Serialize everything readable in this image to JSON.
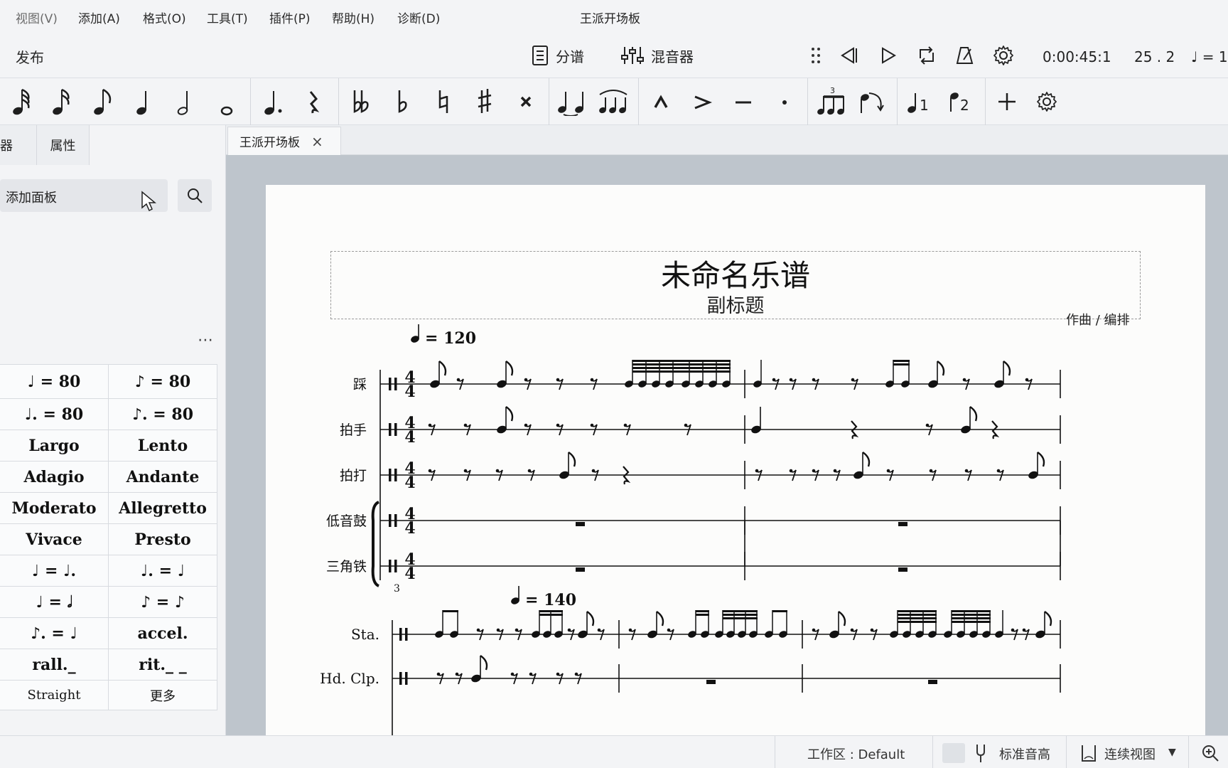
{
  "menu": {
    "items": [
      "视图(V)",
      "添加(A)",
      "格式(O)",
      "工具(T)",
      "插件(P)",
      "帮助(H)",
      "诊断(D)"
    ],
    "window_title": "王派开场板"
  },
  "toolbar": {
    "publish": "发布",
    "parts_label": "分谱",
    "mixer_label": "混音器",
    "time": "0:00:45:1",
    "position": "25 . 2",
    "tempo_readout": "= 1"
  },
  "note_input": {
    "durations": [
      "64th-note-icon",
      "32nd-note-icon",
      "eighth-note-icon",
      "quarter-note-icon",
      "half-note-icon",
      "whole-note-icon"
    ],
    "accidentals": [
      "double-flat-icon",
      "flat-icon",
      "natural-icon",
      "sharp-icon",
      "double-sharp-icon"
    ],
    "articulations": [
      "marcato-icon",
      "accent-icon",
      "tenuto-icon",
      "staccato-icon"
    ],
    "voice1": "1",
    "voice2": "2"
  },
  "left_panel": {
    "tab_instruments": "乐器",
    "tab_properties": "属性",
    "add_palette": "添加面板",
    "more": "⋯",
    "tempo_cells": [
      "♩ = 80",
      "♪ = 80",
      "♩. = 80",
      "♪. = 80",
      "Largo",
      "Lento",
      "Adagio",
      "Andante",
      "Moderato",
      "Allegretto",
      "Vivace",
      "Presto",
      "♩ = ♩.",
      "♩. = ♩",
      "♩ = 𝅗𝅥",
      "♪ = ♪",
      "♪. = ♩",
      "accel.",
      "rall._",
      "rit._ _",
      "Straight",
      "更多"
    ]
  },
  "doc_tab": {
    "label": "王派开场板",
    "close": "×"
  },
  "score": {
    "title": "未命名乐谱",
    "subtitle": "副标题",
    "composer": "作曲 / 编排",
    "tempo1": "♩ = 120",
    "tempo2": "♩ = 140",
    "system1_instruments": [
      "踩",
      "拍手",
      "拍打",
      "低音鼓",
      "三角铁"
    ],
    "system2_instruments": [
      "Sta.",
      "Hd. Clp."
    ],
    "measure_number": "3"
  },
  "status": {
    "workspace": "工作区 : Default",
    "concert_pitch": "标准音高",
    "view_mode": "连续视图",
    "dropdown": "▼"
  }
}
